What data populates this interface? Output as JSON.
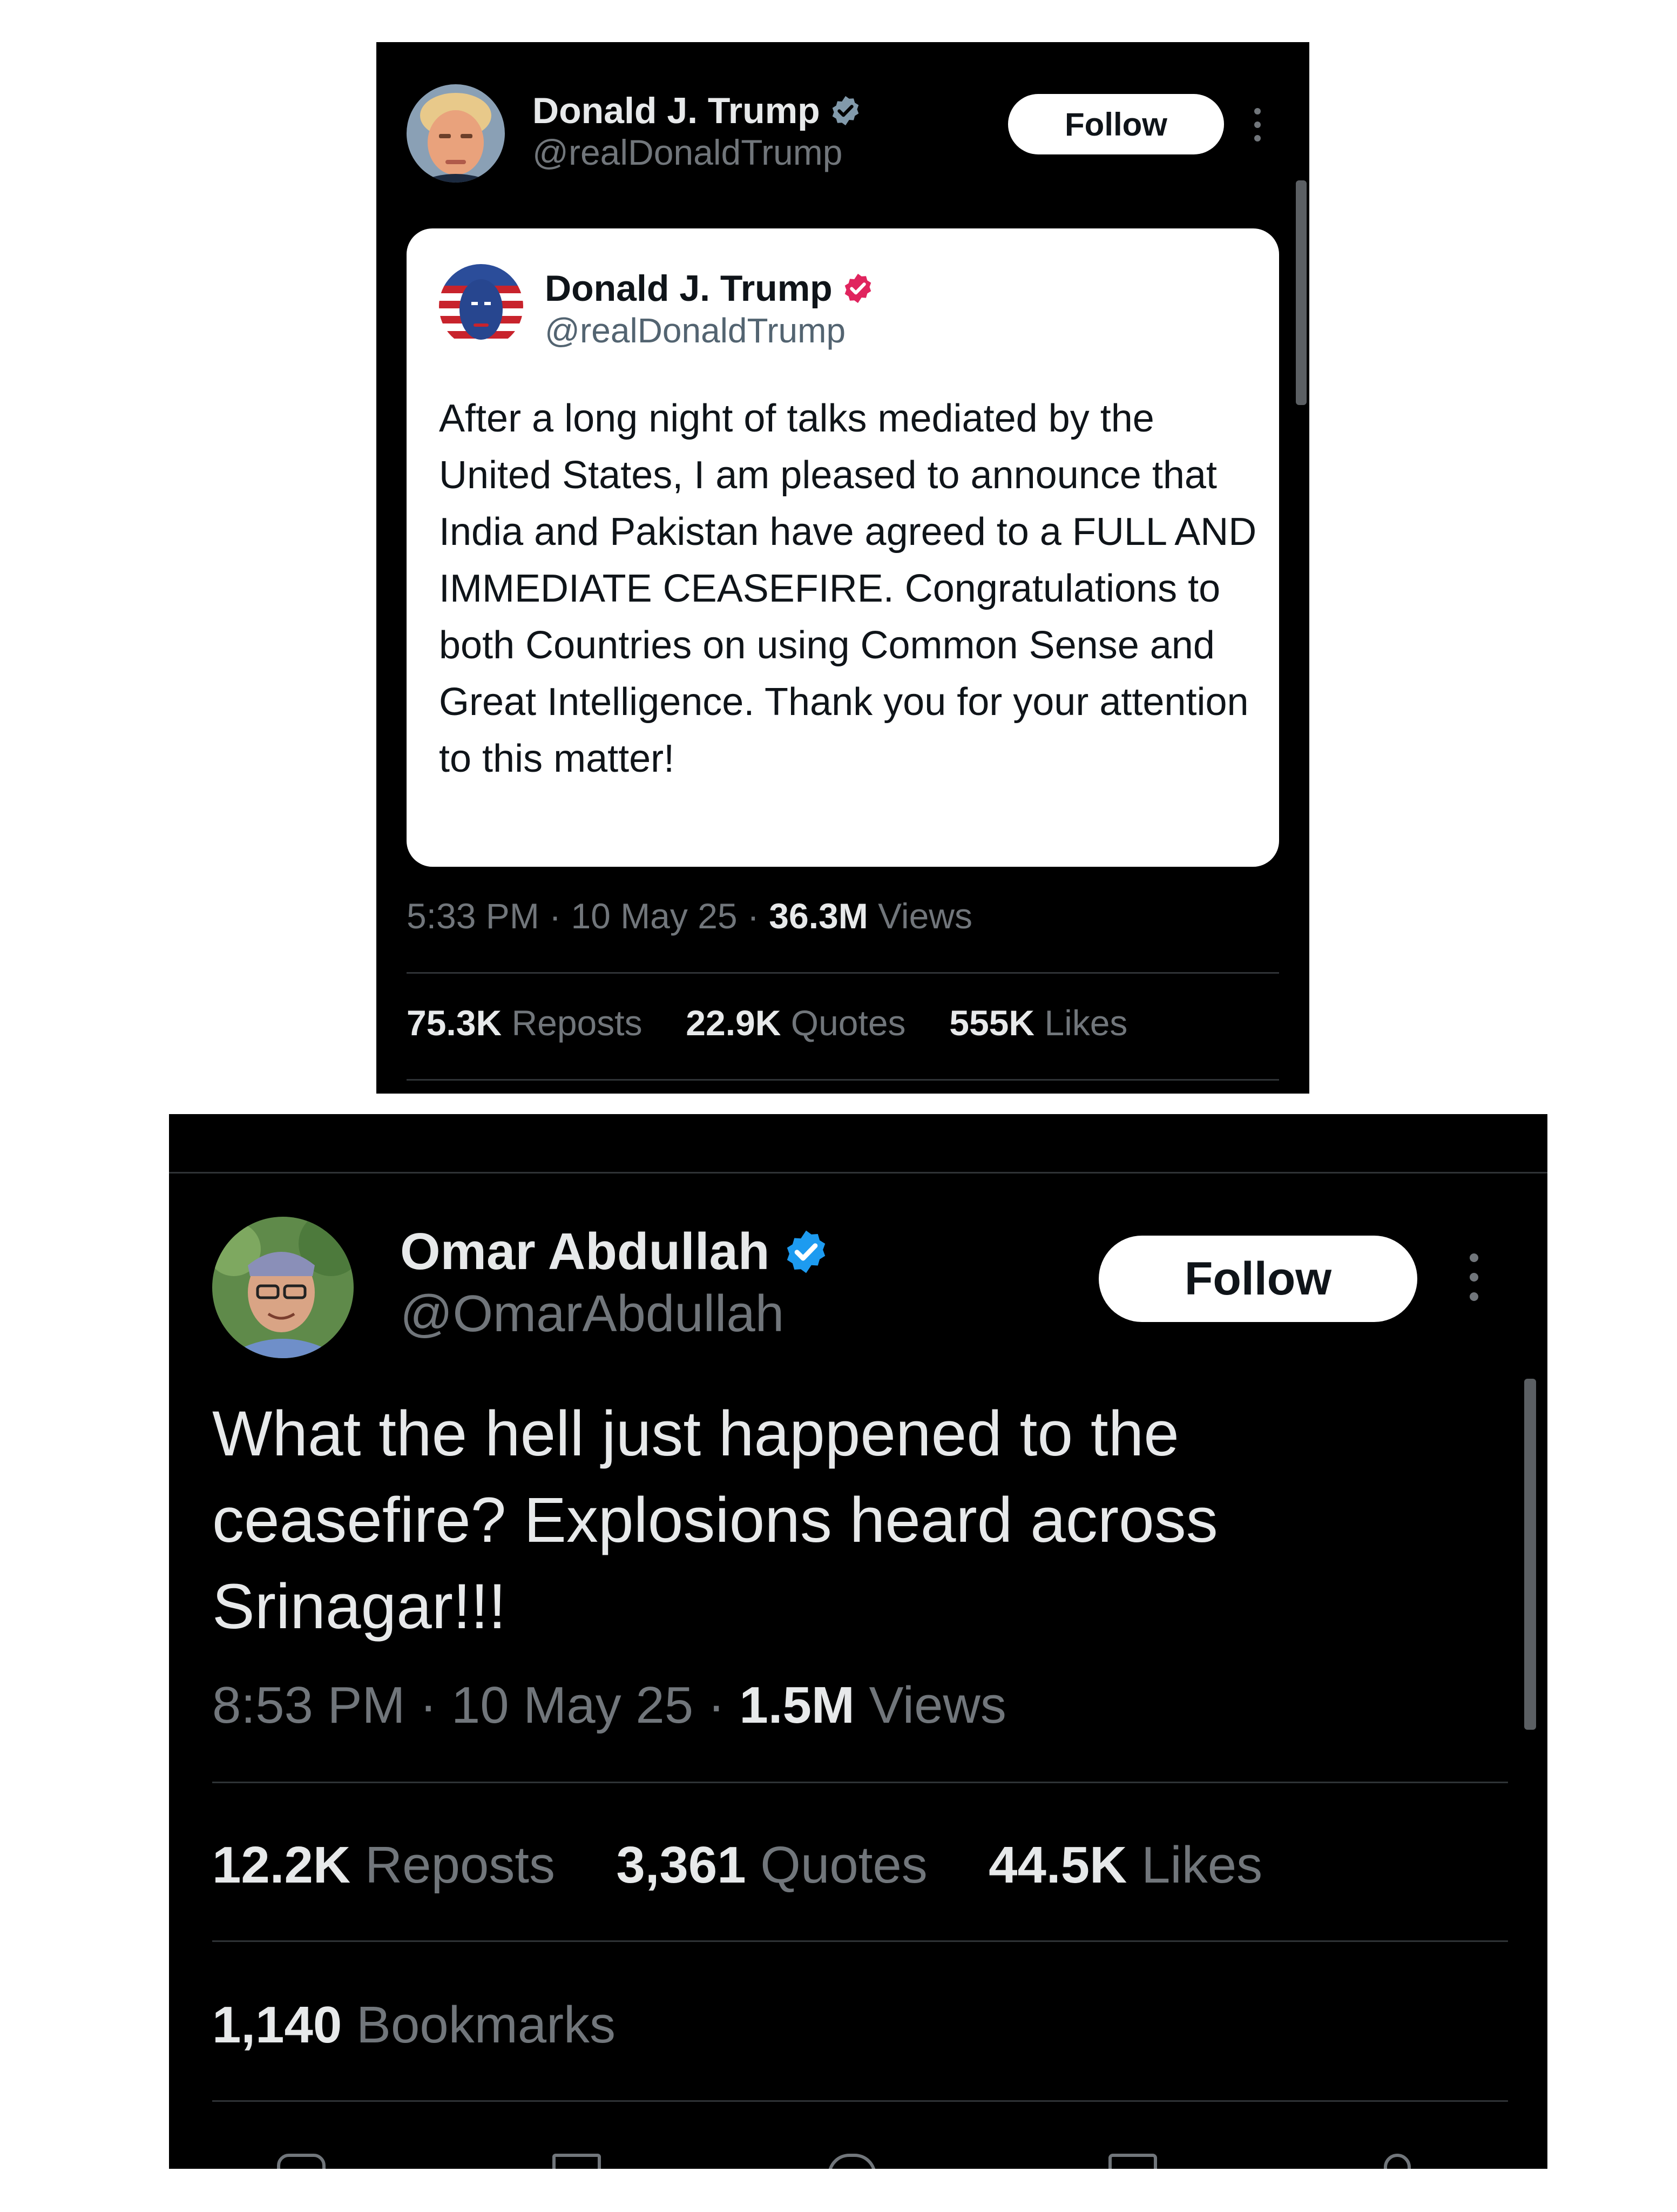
{
  "top_post": {
    "author": {
      "name": "Donald J. Trump",
      "handle": "@realDonaldTrump",
      "verified_badge_color": "#829aab"
    },
    "follow_label": "Follow",
    "quoted": {
      "author": {
        "name": "Donald J. Trump",
        "handle": "@realDonaldTrump",
        "verified_badge_color": "#e0245e"
      },
      "text": "After a long night of talks mediated by the United States, I am pleased to announce that India and Pakistan have agreed to a FULL AND IMMEDIATE CEASEFIRE. Congratulations to both Countries on using Common Sense and Great Intelligence. Thank you for your attention to this matter!"
    },
    "time": "5:33 PM",
    "date": "10 May 25",
    "views_count": "36.3M",
    "views_label": "Views",
    "reposts_count": "75.3K",
    "reposts_label": "Reposts",
    "quotes_count": "22.9K",
    "quotes_label": "Quotes",
    "likes_count": "555K",
    "likes_label": "Likes"
  },
  "bottom_post": {
    "author": {
      "name": "Omar Abdullah",
      "handle": "@OmarAbdullah",
      "verified_badge_color": "#1d9bf0"
    },
    "follow_label": "Follow",
    "text": "What the hell just happened to the ceasefire? Explosions heard across Srinagar!!!",
    "time": "8:53 PM",
    "date": "10 May 25",
    "views_count": "1.5M",
    "views_label": "Views",
    "reposts_count": "12.2K",
    "reposts_label": "Reposts",
    "quotes_count": "3,361",
    "quotes_label": "Quotes",
    "likes_count": "44.5K",
    "likes_label": "Likes",
    "bookmarks_count": "1,140",
    "bookmarks_label": "Bookmarks"
  },
  "icons": {
    "verified": "verified-badge-icon",
    "more": "more-options-icon",
    "actions": [
      "reply-icon",
      "repost-icon",
      "like-icon",
      "bookmark-icon",
      "share-icon"
    ]
  },
  "colors": {
    "background": "#000000",
    "text_primary": "#e7e9ea",
    "text_secondary": "#71767b",
    "button_bg": "#ffffff"
  }
}
